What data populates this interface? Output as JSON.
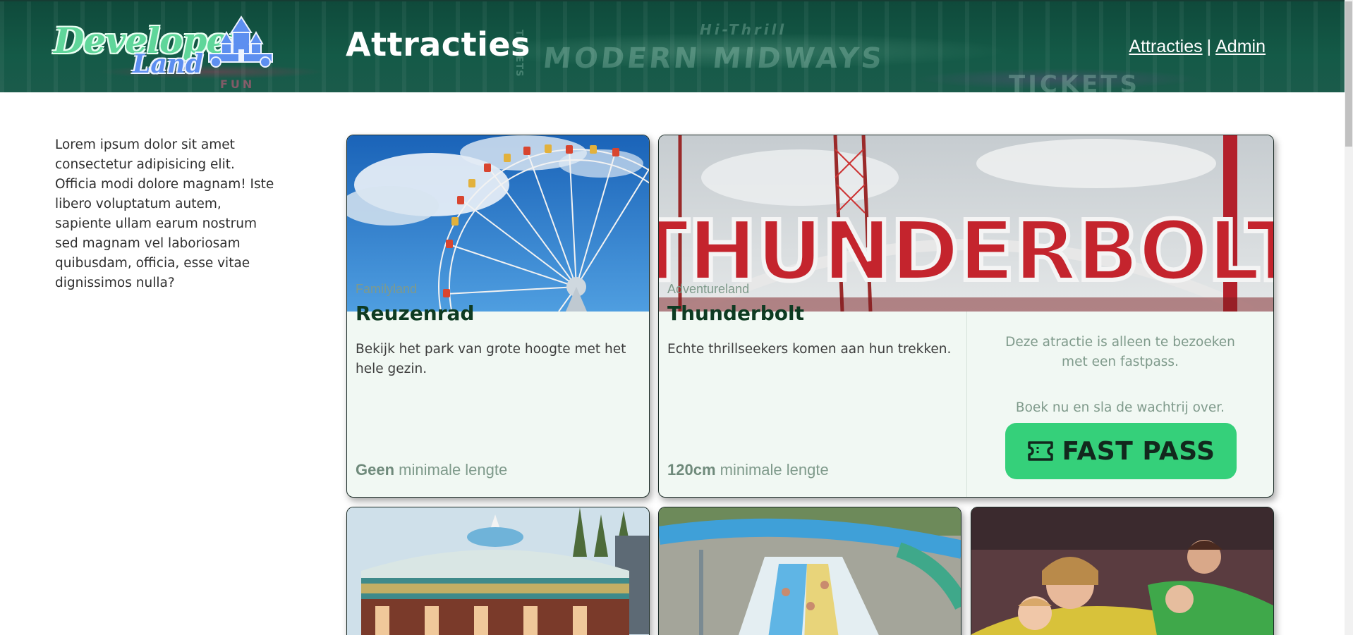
{
  "header": {
    "logo_line1": "Developer",
    "logo_line2": "Land",
    "title": "Attracties",
    "nav": [
      {
        "label": "Attracties"
      },
      {
        "label": "Admin"
      }
    ],
    "nav_separator": "|",
    "background_signs": [
      "MODERN MIDWAYS",
      "TICKETS",
      "TICKETS",
      "FUN",
      "Hi-Thrill"
    ]
  },
  "sidebar": {
    "intro": "Lorem ipsum dolor sit amet consectetur adipisicing elit. Officia modi dolore magnam! Iste libero voluptatum autem, sapiente ullam earum nostrum sed magnam vel laboriosam quibusdam, officia, esse vitae dignissimos nulla?"
  },
  "attractions": [
    {
      "zone": "Familyland",
      "name": "Reuzenrad",
      "description": "Bekijk het park van grote hoogte met het hele gezin.",
      "min_height_value": "Geen",
      "min_height_label": "minimale lengte",
      "image": "ferris-wheel-photo"
    },
    {
      "zone": "Adventureland",
      "name": "Thunderbolt",
      "sign_text": "THUNDERBOLT",
      "description": "Echte thrillseekers komen aan hun trekken.",
      "min_height_value": "120cm",
      "min_height_label": "minimale lengte",
      "image": "thunderbolt-sign-photo",
      "fastpass": {
        "text": "Deze atractie is alleen te bezoeken met een fastpass.",
        "cta_text": "Boek nu en sla de wachtrij over.",
        "button_label": "FAST PASS",
        "button_icon": "ticket-icon"
      }
    },
    {
      "image": "carousel-photo"
    },
    {
      "image": "water-slide-photo"
    },
    {
      "image": "bumper-car-family-photo"
    }
  ],
  "colors": {
    "header_bg": "#145a47",
    "card_bg": "#f1f8f3",
    "accent_green": "#35d07a",
    "title_green": "#0e3b22",
    "muted_green": "#7f9a8b"
  }
}
